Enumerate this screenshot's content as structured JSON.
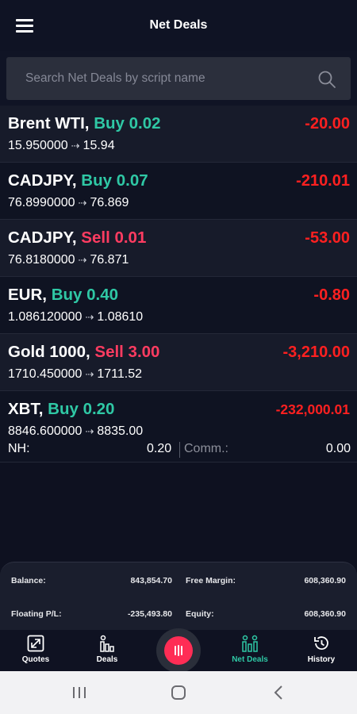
{
  "header": {
    "title": "Net Deals",
    "menu_icon": "hamburger-menu-icon"
  },
  "search": {
    "placeholder": "Search Net Deals by script name",
    "value": "",
    "icon": "search-icon"
  },
  "deals": [
    {
      "symbol": "Brent WTI,",
      "side": "Buy 0.02",
      "side_type": "buy",
      "open": "15.950000",
      "current": "15.94",
      "profit": "-20.00"
    },
    {
      "symbol": "CADJPY,",
      "side": "Buy 0.07",
      "side_type": "buy",
      "open": "76.8990000",
      "current": "76.869",
      "profit": "-210.01"
    },
    {
      "symbol": "CADJPY,",
      "side": "Sell 0.01",
      "side_type": "sell",
      "open": "76.8180000",
      "current": "76.871",
      "profit": "-53.00"
    },
    {
      "symbol": "EUR,",
      "side": "Buy 0.40",
      "side_type": "buy",
      "open": "1.086120000",
      "current": "1.08610",
      "profit": "-0.80"
    },
    {
      "symbol": "Gold 1000,",
      "side": "Sell 3.00",
      "side_type": "sell",
      "open": "1710.450000",
      "current": "1711.52",
      "profit": "-3,210.00"
    },
    {
      "symbol": "XBT,",
      "side": "Buy 0.20",
      "side_type": "buy",
      "open": "8846.600000",
      "current": "8835.00",
      "profit": "-232,000.01",
      "nh_label": "NH:",
      "nh_value": "0.20",
      "comm_label": "Comm.:",
      "comm_value": "0.00"
    }
  ],
  "summary": {
    "balance_label": "Balance:",
    "balance_value": "843,854.70",
    "free_margin_label": "Free Margin:",
    "free_margin_value": "608,360.90",
    "floating_label": "Floating P/L:",
    "floating_value": "-235,493.80",
    "equity_label": "Equity:",
    "equity_value": "608,360.90"
  },
  "bottom_nav": {
    "quotes": "Quotes",
    "deals": "Deals",
    "net_deals": "Net Deals",
    "history": "History",
    "active": "net_deals"
  },
  "colors": {
    "buy": "#2fc8a5",
    "sell": "#ff3c61",
    "loss": "#ff2020",
    "background": "#0e1120"
  }
}
